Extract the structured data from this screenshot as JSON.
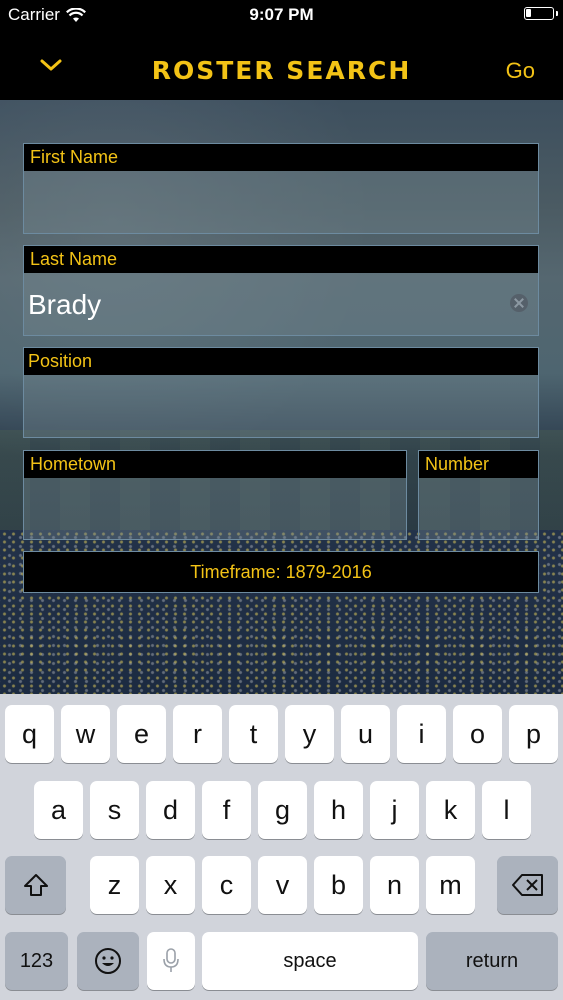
{
  "status_bar": {
    "carrier": "Carrier",
    "time": "9:07 PM"
  },
  "nav": {
    "title": "ROSTER SEARCH",
    "go_label": "Go"
  },
  "form": {
    "first_name": {
      "label": "First Name",
      "value": ""
    },
    "last_name": {
      "label": "Last Name",
      "value": "Brady"
    },
    "position": {
      "label": "Position",
      "value": ""
    },
    "hometown": {
      "label": "Hometown",
      "value": ""
    },
    "number": {
      "label": "Number",
      "value": ""
    },
    "timeframe": "Timeframe: 1879-2016"
  },
  "keyboard": {
    "row1": [
      "q",
      "w",
      "e",
      "r",
      "t",
      "y",
      "u",
      "i",
      "o",
      "p"
    ],
    "row2": [
      "a",
      "s",
      "d",
      "f",
      "g",
      "h",
      "j",
      "k",
      "l"
    ],
    "row3": [
      "z",
      "x",
      "c",
      "v",
      "b",
      "n",
      "m"
    ],
    "numbers_label": "123",
    "space_label": "space",
    "return_label": "return"
  },
  "colors": {
    "accent": "#f3c316",
    "nav_bg": "#000000",
    "keyboard_bg": "#d1d4db"
  }
}
